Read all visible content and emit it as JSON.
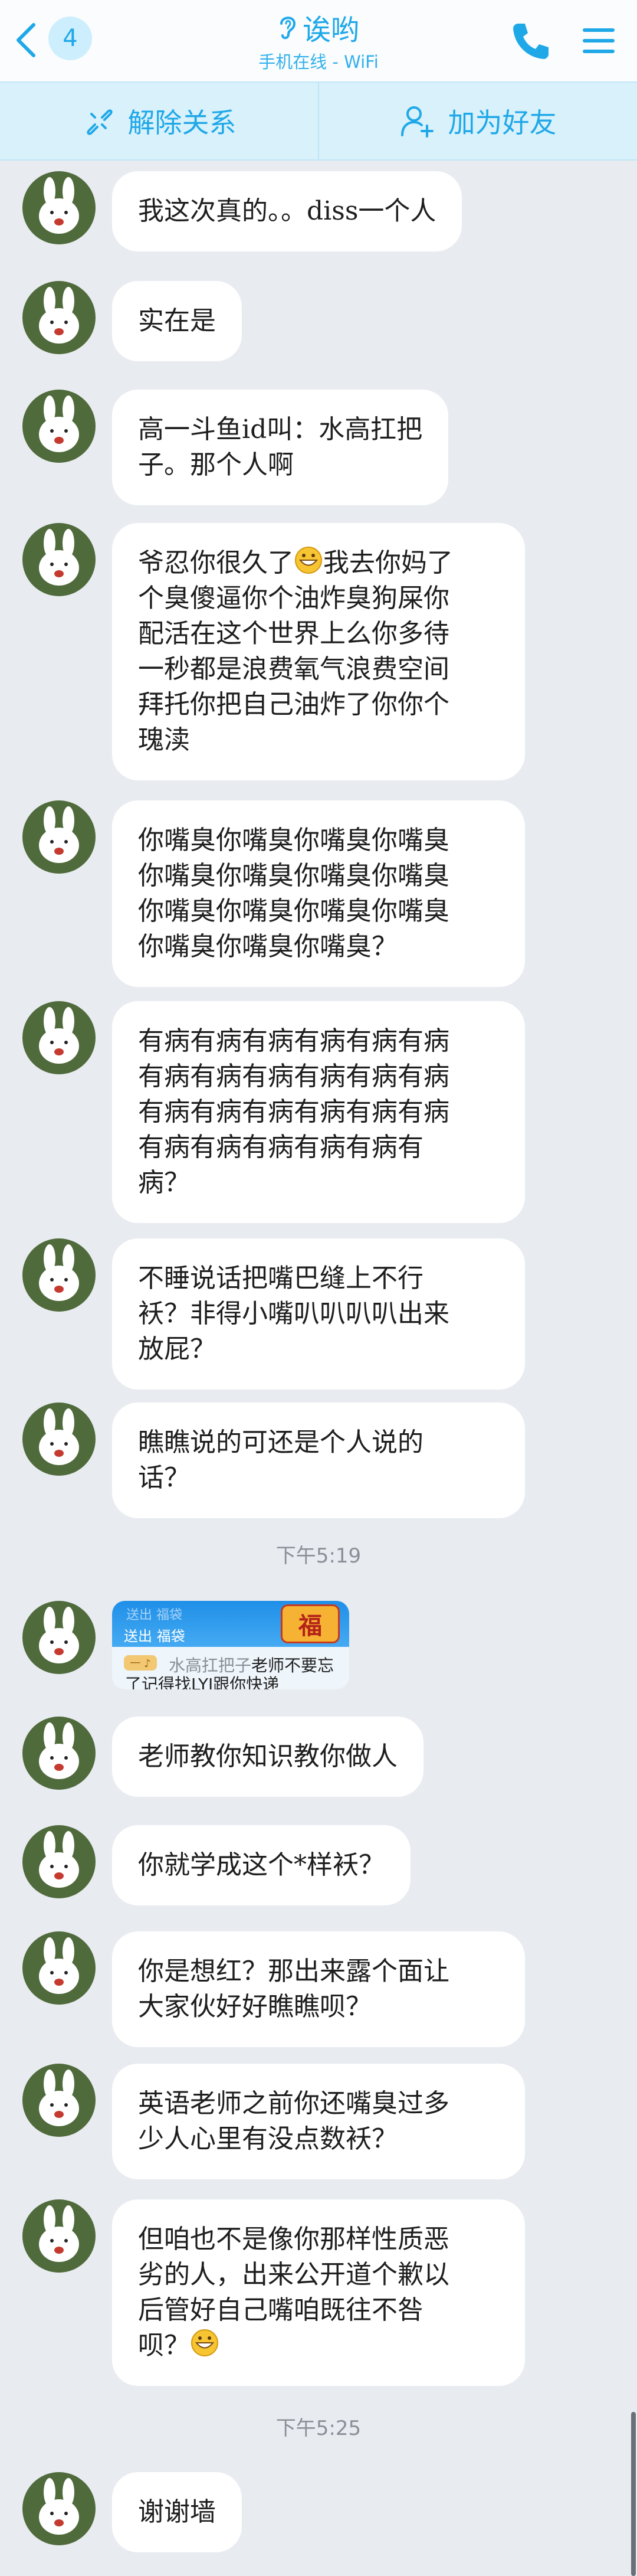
{
  "header": {
    "back_count": "4",
    "title": "诶哟",
    "subtitle": "手机在线 - WiFi",
    "icons": {
      "back": "chevron-left-icon",
      "status": "ear-icon",
      "phone": "phone-icon",
      "menu": "menu-icon"
    }
  },
  "actions": {
    "unfriend": "解除关系",
    "add_friend": "加为好友"
  },
  "messages": {
    "m1": "我这次真的。。diss一个人",
    "m2": "实在是",
    "m3": "高一斗鱼id叫：水高扛把\n子。那个人啊",
    "m4_a": "爷忍你很久了",
    "m4_b": "我去你妈了\n个臭傻逼你个油炸臭狗屎你\n配活在这个世界上么你多待\n一秒都是浪费氧气浪费空间\n拜托你把自己油炸了你你个\n瑰渎",
    "m5": "你嘴臭你嘴臭你嘴臭你嘴臭\n你嘴臭你嘴臭你嘴臭你嘴臭\n你嘴臭你嘴臭你嘴臭你嘴臭\n你嘴臭你嘴臭你嘴臭？",
    "m6": "有病有病有病有病有病有病\n有病有病有病有病有病有病\n有病有病有病有病有病有病\n有病有病有病有病有病有\n病？",
    "m7": "不睡说话把嘴巴缝上不行\n袄？非得小嘴叭叭叭叭出来\n放屁？",
    "m8": "瞧瞧说的可还是个人说的\n话？",
    "time1": "下午5:19",
    "card": {
      "faded": "送出 福袋",
      "label": "送出 福袋",
      "badge": "福",
      "tag": "一 ♪",
      "name": "水高扛把子",
      "line1_rest": "老师不要忘",
      "line2": "了记得找LYJ跟你快递"
    },
    "m9": "老师教你知识教你做人",
    "m10": "你就学成这个*样袄？",
    "m11": "你是想红？那出来露个面让\n大家伙好好瞧瞧呗？",
    "m12": "英语老师之前你还嘴臭过多\n少人心里有没点数袄？",
    "m13": "但咱也不是像你那样性质恶\n劣的人，出来公开道个歉以\n后管好自己嘴咱既往不咎\n呗？",
    "time2": "下午5:25",
    "m14": "谢谢墙"
  },
  "colors": {
    "accent": "#1fa8e8",
    "bg": "#e8ebf0",
    "bubble": "#ffffff",
    "avatar": "#4f6a3b"
  }
}
